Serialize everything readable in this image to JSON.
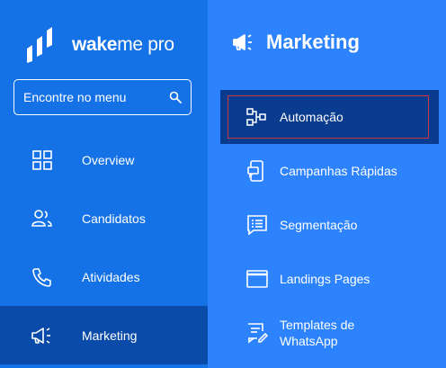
{
  "brand": {
    "name_bold": "wake",
    "name_rest": "me pro"
  },
  "search": {
    "placeholder": "Encontre no menu"
  },
  "sidebar": {
    "items": [
      {
        "label": "Overview",
        "icon": "grid-icon"
      },
      {
        "label": "Candidatos",
        "icon": "users-icon"
      },
      {
        "label": "Atividades",
        "icon": "phone-icon"
      },
      {
        "label": "Marketing",
        "icon": "megaphone-icon",
        "active": true
      }
    ]
  },
  "panel": {
    "title": "Marketing",
    "items": [
      {
        "label": "Automação",
        "icon": "flow-icon",
        "active": true
      },
      {
        "label": "Campanhas Rápidas",
        "icon": "mobile-message-icon"
      },
      {
        "label": "Segmentação",
        "icon": "list-chat-icon"
      },
      {
        "label": "Landings Pages",
        "icon": "browser-window-icon"
      },
      {
        "label": "Templates de WhatsApp",
        "icon": "template-edit-icon"
      }
    ]
  },
  "colors": {
    "sidebar_bg": "#1471e6",
    "sidebar_active": "#0a4aa8",
    "panel_bg": "#2c83fd",
    "panel_active": "#093b8f",
    "focus_border": "#c8383f"
  }
}
